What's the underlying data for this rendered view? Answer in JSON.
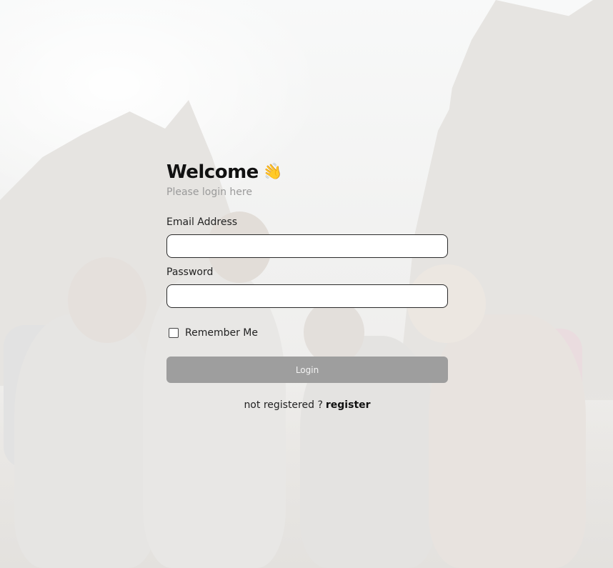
{
  "login": {
    "title": "Welcome",
    "wave_emoji": "👋",
    "subtitle": "Please login here",
    "email_label": "Email Address",
    "email_value": "",
    "password_label": "Password",
    "password_value": "",
    "remember_label": "Remember Me",
    "remember_checked": false,
    "login_button": "Login",
    "register_prompt": "not registered ?",
    "register_link": "register"
  },
  "icons": {
    "wave": "waving-hand-icon"
  },
  "colors": {
    "button_bg": "#9e9e9e",
    "input_border": "#2a2a2a",
    "subtitle": "#9a9a9a"
  }
}
